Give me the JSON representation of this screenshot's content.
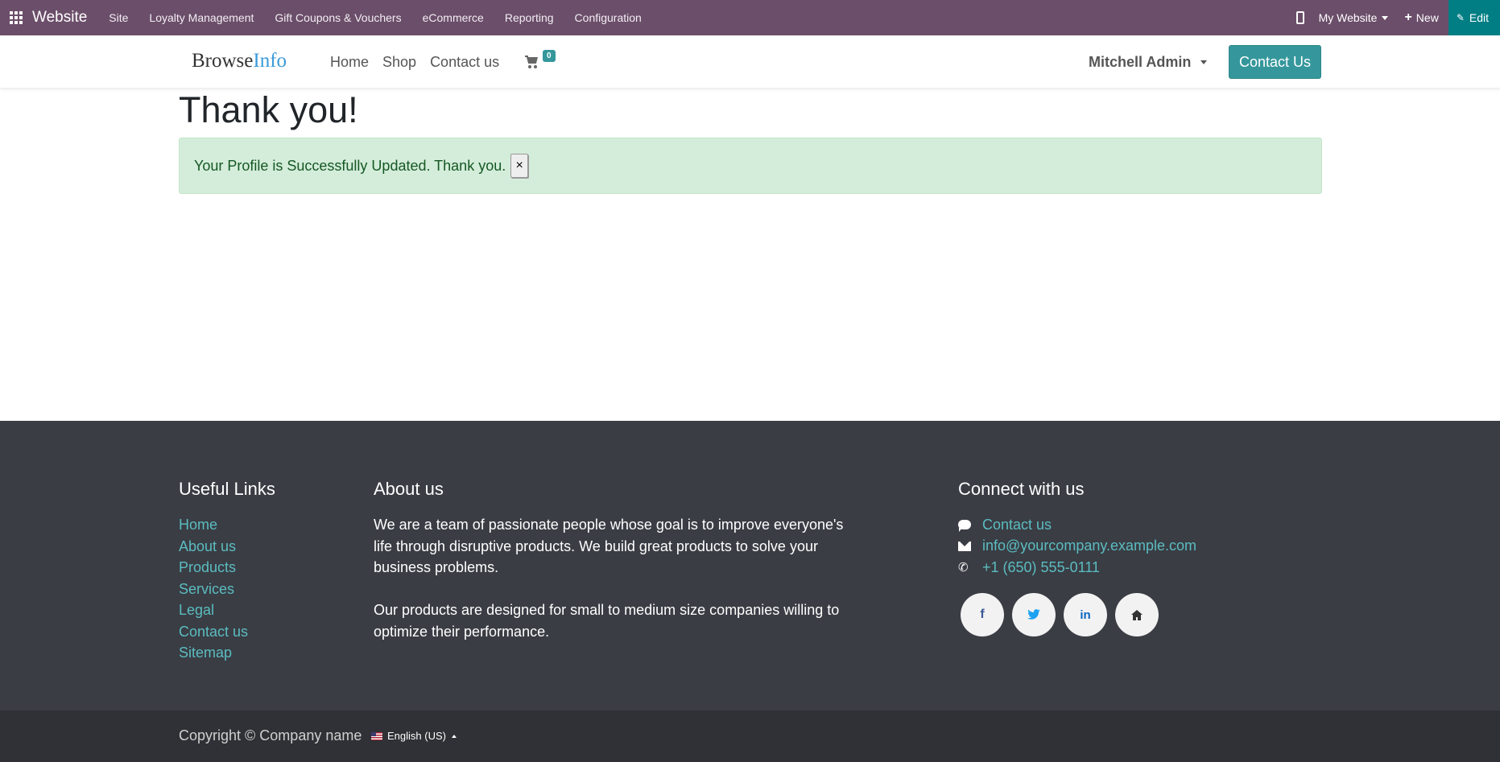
{
  "admin_bar": {
    "app_name": "Website",
    "menu": [
      "Site",
      "Loyalty Management",
      "Gift Coupons & Vouchers",
      "eCommerce",
      "Reporting",
      "Configuration"
    ],
    "website_switcher": "My Website",
    "new_label": "New",
    "edit_label": "Edit",
    "bg_color": "#6b4e6a",
    "edit_color": "#017e84"
  },
  "header": {
    "logo_browse": "Browse",
    "logo_info": "Info",
    "nav": [
      "Home",
      "Shop",
      "Contact us"
    ],
    "cart_count": "0",
    "user": "Mitchell Admin",
    "cta": "Contact Us",
    "accent_color": "#35979c"
  },
  "main": {
    "title": "Thank you!",
    "alert_message": "Your Profile is Successfully Updated. Thank you.",
    "alert_close": "×"
  },
  "footer": {
    "useful_links_title": "Useful Links",
    "useful_links": [
      "Home",
      "About us",
      "Products",
      "Services",
      "Legal",
      "Contact us",
      "Sitemap"
    ],
    "about_title": "About us",
    "about_p1": "We are a team of passionate people whose goal is to improve everyone's life through disruptive products. We build great products to solve your business problems.",
    "about_p2": "Our products are designed for small to medium size companies willing to optimize their performance.",
    "connect_title": "Connect with us",
    "contact_link": "Contact us",
    "email": "info@yourcompany.example.com",
    "phone": "+1 (650) 555-0111",
    "social_icons": [
      "facebook-icon",
      "twitter-icon",
      "linkedin-icon",
      "home-icon"
    ]
  },
  "copyright": {
    "text": "Copyright © Company name",
    "language": "English (US)"
  }
}
